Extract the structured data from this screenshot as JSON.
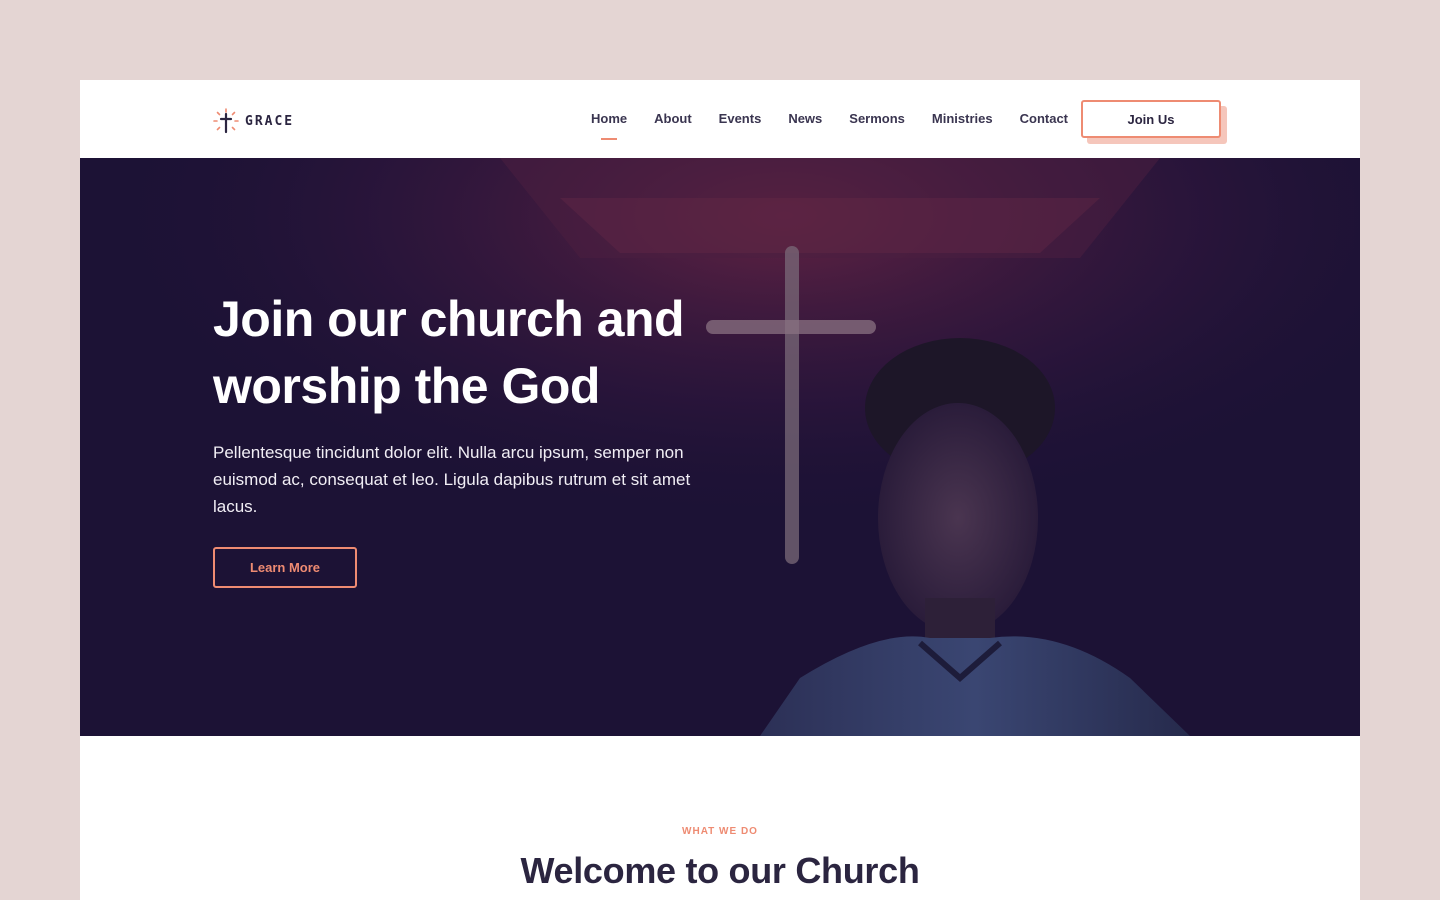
{
  "brand": {
    "name": "GRACE",
    "icon": "cross-sunburst-icon",
    "accent": "#ee8b72"
  },
  "nav": {
    "items": [
      {
        "label": "Home",
        "active": true
      },
      {
        "label": "About"
      },
      {
        "label": "Events"
      },
      {
        "label": "News"
      },
      {
        "label": "Sermons"
      },
      {
        "label": "Ministries"
      },
      {
        "label": "Contact"
      }
    ],
    "cta_label": "Join Us"
  },
  "hero": {
    "title": "Join our church and worship the God",
    "text": "Pellentesque tincidunt dolor elit. Nulla arcu ipsum, semper non euismod ac, consequat et leo. Ligula dapibus rutrum et sit amet lacus.",
    "button_label": "Learn More",
    "background": "#1c1235"
  },
  "section": {
    "eyebrow": "WHAT WE DO",
    "title": "Welcome to our Church"
  }
}
